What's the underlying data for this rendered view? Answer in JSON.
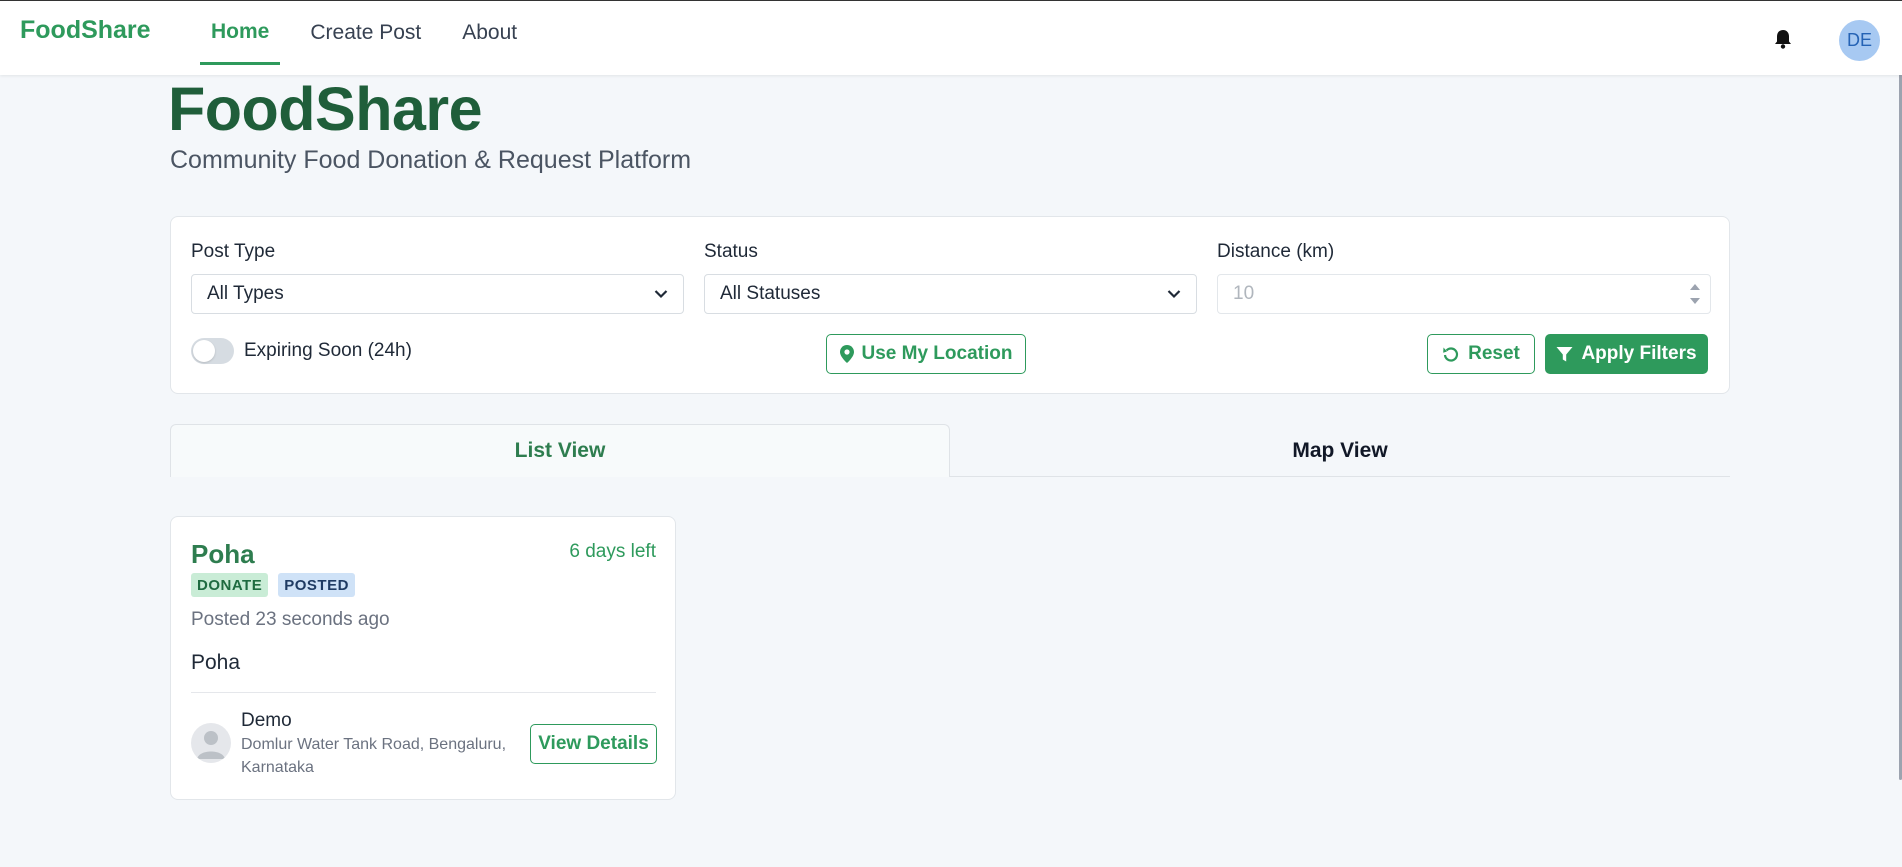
{
  "navbar": {
    "brand": "FoodShare",
    "links": [
      {
        "label": "Home",
        "active": true
      },
      {
        "label": "Create Post",
        "active": false
      },
      {
        "label": "About",
        "active": false
      }
    ],
    "user_initials": "DE",
    "icons": {
      "notifications": "bell-icon"
    }
  },
  "header": {
    "title": "FoodShare",
    "subtitle": "Community Food Donation & Request Platform"
  },
  "filters": {
    "post_type": {
      "label": "Post Type",
      "value": "All Types"
    },
    "status": {
      "label": "Status",
      "value": "All Statuses"
    },
    "distance": {
      "label": "Distance (km)",
      "placeholder": "10"
    },
    "expiring_toggle": {
      "label": "Expiring Soon (24h)",
      "on": false
    },
    "location_button": "Use My Location",
    "reset_button": "Reset",
    "apply_button": "Apply Filters"
  },
  "tabs": [
    {
      "label": "List View",
      "active": true
    },
    {
      "label": "Map View",
      "active": false
    }
  ],
  "posts": [
    {
      "title": "Poha",
      "time_left": "6 days left",
      "badges": [
        "DONATE",
        "POSTED"
      ],
      "posted": "Posted 23 seconds ago",
      "description": "Poha",
      "user_name": "Demo",
      "address": "Domlur Water Tank Road, Bengaluru, Karnataka",
      "action_label": "View Details"
    }
  ],
  "colors": {
    "primary": "#2e9a5c",
    "title": "#1f5e3a",
    "background": "#f4f7fa",
    "avatar_bg": "#a7c9f2"
  }
}
